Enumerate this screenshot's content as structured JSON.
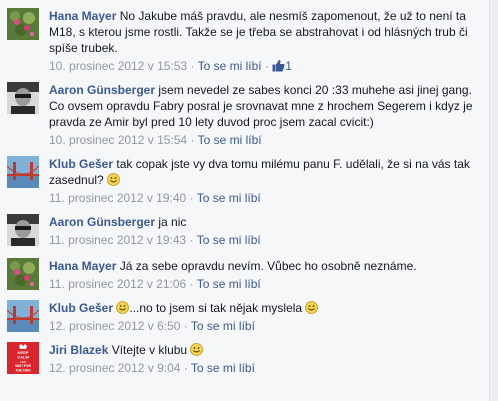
{
  "comments": [
    {
      "author": "Hana Mayer",
      "text": "No Jakube máš pravdu, ale nesmíš zapomenout, že už to není ta M18, s kterou jsme rostli. Takže se je třeba se abstrahovat i od hlásných trub či spíše trubek.",
      "timestamp": "10. prosinec 2012 v 15:53",
      "like_label": "To se mi líbí",
      "like_count": "1",
      "avatar": "flowers-avatar"
    },
    {
      "author": "Aaron Günsberger",
      "text": "jsem nevedel ze sabes konci 20 :33 muhehe asi jinej gang. Co ovsem opravdu Fabry posral je srovnavat mne z hrochem Segerem i kdyz je pravda ze Amir byl pred 10 lety duvod proc jsem zacal cvicit:)",
      "timestamp": "10. prosinec 2012 v 15:54",
      "like_label": "To se mi líbí",
      "avatar": "man-bw-avatar"
    },
    {
      "author": "Klub Gešer",
      "text": "tak copak jste vy dva tomu milému panu F. udělali, že si na vás tak zasednul?",
      "timestamp": "11. prosinec 2012 v 19:40",
      "like_label": "To se mi líbí",
      "avatar": "bridge-avatar"
    },
    {
      "author": "Aaron Günsberger",
      "text": "ja nic",
      "timestamp": "11. prosinec 2012 v 19:43",
      "like_label": "To se mi líbí",
      "avatar": "man-bw-avatar"
    },
    {
      "author": "Hana Mayer",
      "text": "Já za sebe opravdu nevím. Vůbec ho osobně neznáme.",
      "timestamp": "11. prosinec 2012 v 21:06",
      "like_label": "To se mi líbí",
      "avatar": "flowers-avatar"
    },
    {
      "author": "Klub Gešer",
      "text": "...no to jsem si tak nějak myslela",
      "timestamp": "12. prosinec 2012 v 6:50",
      "like_label": "To se mi líbí",
      "avatar": "bridge-avatar"
    },
    {
      "author": "Jiri Blazek",
      "text": "Vítejte v klubu",
      "timestamp": "12. prosinec 2012 v 9:04",
      "like_label": "To se mi líbí",
      "avatar": "keep-calm-avatar",
      "avatar_text": [
        "KEEP",
        "CALM",
        "AND",
        "WAIT FOR",
        "THE KING"
      ]
    }
  ],
  "separator": "·",
  "colors": {
    "link": "#3b5998",
    "meta": "#9197a3",
    "background": "#f6f7f9",
    "keep_calm_red": "#d8262c"
  }
}
